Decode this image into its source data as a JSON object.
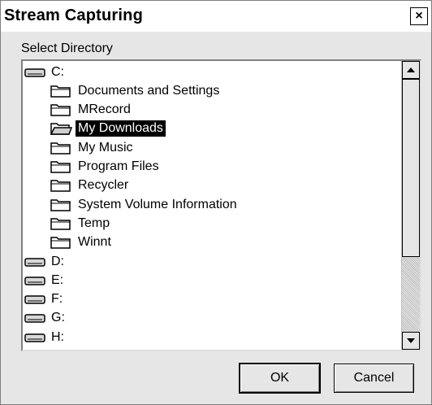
{
  "window": {
    "title": "Stream Capturing",
    "close_glyph": "×"
  },
  "select_directory_label": "Select Directory",
  "tree": [
    {
      "label": "C:",
      "type": "drive",
      "level": 0,
      "icon": "drive-icon"
    },
    {
      "label": "Documents and Settings",
      "type": "folder",
      "level": 1,
      "icon": "folder-icon"
    },
    {
      "label": "MRecord",
      "type": "folder",
      "level": 1,
      "icon": "folder-icon"
    },
    {
      "label": "My Downloads",
      "type": "folder",
      "level": 1,
      "icon": "open-folder-icon",
      "selected": true
    },
    {
      "label": "My Music",
      "type": "folder",
      "level": 1,
      "icon": "folder-icon"
    },
    {
      "label": "Program Files",
      "type": "folder",
      "level": 1,
      "icon": "folder-icon"
    },
    {
      "label": "Recycler",
      "type": "folder",
      "level": 1,
      "icon": "folder-icon"
    },
    {
      "label": "System Volume Information",
      "type": "folder",
      "level": 1,
      "icon": "folder-icon"
    },
    {
      "label": "Temp",
      "type": "folder",
      "level": 1,
      "icon": "folder-icon"
    },
    {
      "label": "Winnt",
      "type": "folder",
      "level": 1,
      "icon": "folder-icon"
    },
    {
      "label": "D:",
      "type": "drive",
      "level": 0,
      "icon": "drive-icon"
    },
    {
      "label": "E:",
      "type": "drive",
      "level": 0,
      "icon": "drive-icon"
    },
    {
      "label": "F:",
      "type": "drive",
      "level": 0,
      "icon": "drive-icon"
    },
    {
      "label": "G:",
      "type": "drive",
      "level": 0,
      "icon": "drive-icon"
    },
    {
      "label": "H:",
      "type": "drive",
      "level": 0,
      "icon": "drive-icon"
    }
  ],
  "buttons": {
    "ok": "OK",
    "cancel": "Cancel"
  },
  "colors": {
    "background": "#e6e6e6",
    "selection": "#000000"
  }
}
